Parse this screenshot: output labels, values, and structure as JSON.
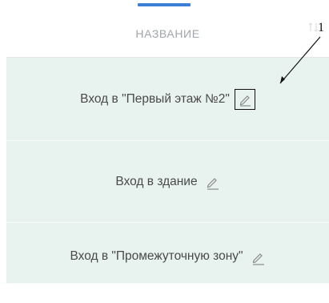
{
  "table": {
    "column_header": "НАЗВАНИЕ",
    "sort_icon": "sort-arrows-icon",
    "rows": [
      {
        "label": "Вход в \"Первый этаж №2\"",
        "icon": "pencil-edit-icon"
      },
      {
        "label": "Вход в здание",
        "icon": "pencil-edit-icon"
      },
      {
        "label": "Вход в \"Промежуточную зону\"",
        "icon": "pencil-edit-icon"
      }
    ]
  },
  "annotation": {
    "callout_number": "1"
  },
  "colors": {
    "accent": "#3b7fd6",
    "row_background": "#e8f2ee",
    "header_text": "#a0a6aa",
    "row_text": "#4a4a4a"
  }
}
